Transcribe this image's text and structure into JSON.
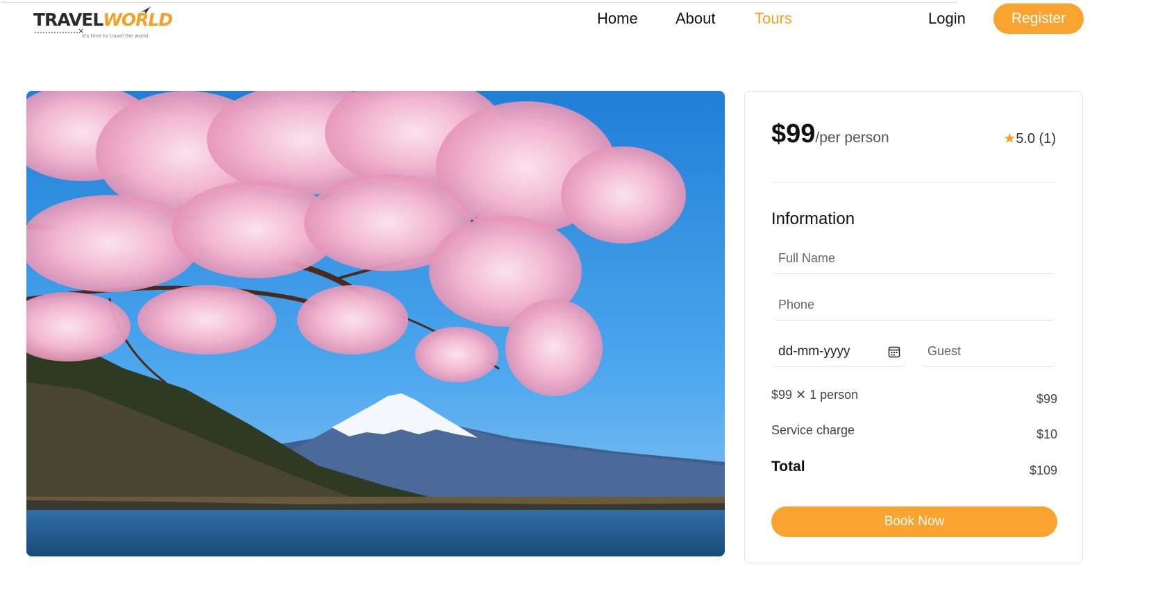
{
  "header": {
    "logo": {
      "travel": "TRAVEL",
      "world": "WORLD",
      "tagline": "it's time to travel the world"
    },
    "nav": [
      {
        "label": "Home"
      },
      {
        "label": "About"
      },
      {
        "label": "Tours",
        "active": true
      }
    ],
    "login_label": "Login",
    "register_label": "Register"
  },
  "hero": {
    "image_icon": "cherry-blossom-mount-fuji-photo"
  },
  "booking": {
    "price": "$99",
    "price_unit": "/per person",
    "rating_star": "★",
    "rating": "5.0 (1)",
    "info_title": "Information",
    "full_name_placeholder": "Full Name",
    "phone_placeholder": "Phone",
    "date_value": "dd-mm-yyyy",
    "guest_placeholder": "Guest",
    "line_item_label": "$99 ✕ 1 person",
    "line_item_value": "$99",
    "service_label": "Service charge",
    "service_value": "$10",
    "total_label": "Total",
    "total_value": "$109",
    "book_label": "Book Now"
  },
  "colors": {
    "accent": "#f9a430",
    "text": "#111111",
    "muted": "#555555"
  }
}
